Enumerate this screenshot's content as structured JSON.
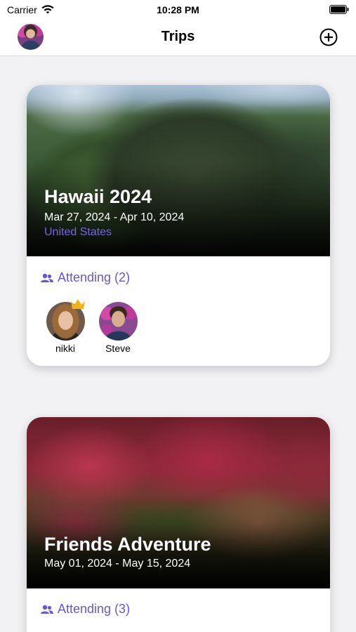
{
  "status_bar": {
    "carrier": "Carrier",
    "time": "10:28 PM",
    "icons": [
      "wifi-icon",
      "battery-icon"
    ]
  },
  "nav": {
    "title": "Trips",
    "left_icon": "profile-avatar",
    "right_icon": "add-circle-icon"
  },
  "trips": [
    {
      "title": "Hawaii 2024",
      "dates": "Mar 27, 2024 - Apr 10, 2024",
      "country": "United States",
      "attending_label": "Attending (2)",
      "attendees": [
        {
          "name": "nikki",
          "is_organizer": true
        },
        {
          "name": "Steve",
          "is_organizer": false
        }
      ]
    },
    {
      "title": "Friends Adventure",
      "dates": "May 01, 2024 - May 15, 2024",
      "attending_label": "Attending (3)"
    }
  ],
  "colors": {
    "accent": "#6a55d8",
    "country": "#7b63e6",
    "crown": "#f2b418"
  }
}
